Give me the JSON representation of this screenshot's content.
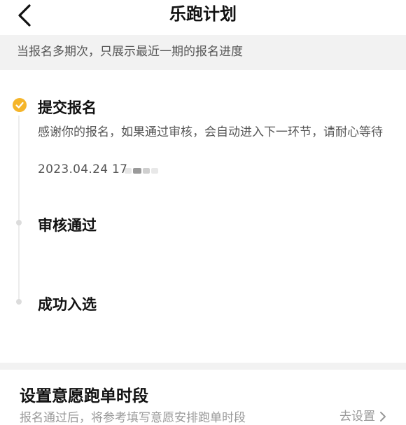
{
  "header": {
    "title": "乐跑计划",
    "back_icon": "back-arrow-icon"
  },
  "notice": {
    "text": "当报名多期次，只展示最近一期的报名进度"
  },
  "timeline": {
    "steps": [
      {
        "title": "提交报名",
        "status": "done",
        "description": "感谢你的报名，如果通过审核，会自动进入下一环节，请耐心等待",
        "time": "2023.04.24 17"
      },
      {
        "title": "审核通过",
        "status": "pending"
      },
      {
        "title": "成功入选",
        "status": "pending"
      }
    ]
  },
  "setting": {
    "title": "设置意愿跑单时段",
    "description": "报名通过后，将参考填写意愿安排跑单时段",
    "action_label": "去设置"
  },
  "colors": {
    "accent": "#f5b52a",
    "muted_text": "#999999",
    "notice_bg": "#f2f2f2"
  }
}
